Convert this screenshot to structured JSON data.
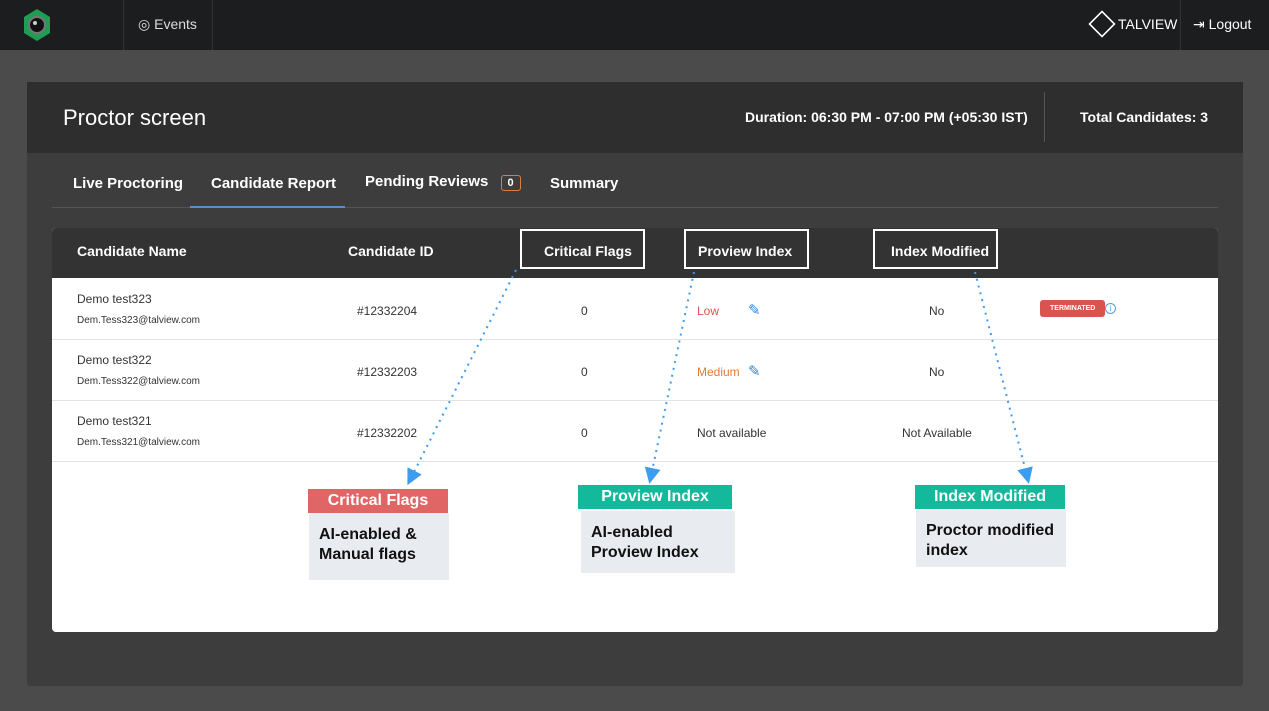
{
  "nav": {
    "events": "Events",
    "brand": "TALVIEW",
    "logout": "Logout"
  },
  "header": {
    "title": "Proctor screen",
    "duration": "Duration: 06:30 PM - 07:00 PM (+05:30 IST)",
    "total": "Total Candidates: 3"
  },
  "tabs": [
    {
      "label": "Live Proctoring"
    },
    {
      "label": "Candidate Report"
    },
    {
      "label": "Pending Reviews",
      "badge": "0"
    },
    {
      "label": "Summary"
    }
  ],
  "table": {
    "headers": [
      "Candidate Name",
      "Candidate ID",
      "Critical Flags",
      "Proview Index",
      "Index Modified"
    ],
    "rows": [
      {
        "name": "Demo test323",
        "email": "Dem.Tess323@talview.com",
        "id": "#12332204",
        "flags": "0",
        "index": "Low",
        "modified": "No",
        "status": "TERMINATED"
      },
      {
        "name": "Demo test322",
        "email": "Dem.Tess322@talview.com",
        "id": "#12332203",
        "flags": "0",
        "index": "Medium",
        "modified": "No"
      },
      {
        "name": "Demo test321",
        "email": "Dem.Tess321@talview.com",
        "id": "#12332202",
        "flags": "0",
        "index": "Not available",
        "modified": "Not Available"
      }
    ]
  },
  "annotations": [
    {
      "title": "Critical Flags",
      "desc": "AI-enabled & Manual flags",
      "color": "#e06666"
    },
    {
      "title": "Proview Index",
      "desc": "AI-enabled Proview Index",
      "color": "#13b99a"
    },
    {
      "title": "Index Modified",
      "desc": "Proctor modified index",
      "color": "#13b99a"
    }
  ]
}
